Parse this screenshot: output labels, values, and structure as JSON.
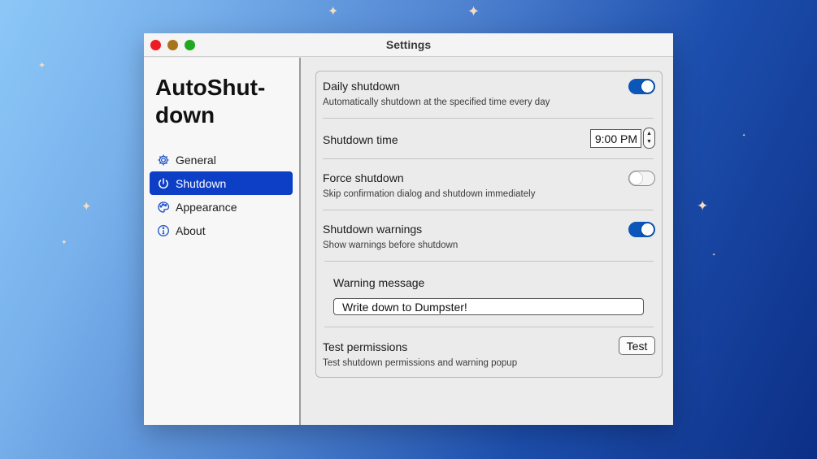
{
  "window": {
    "title": "Settings"
  },
  "sidebar": {
    "app_name": "AutoShut-down",
    "items": [
      {
        "label": "General",
        "icon": "gear-icon",
        "active": false
      },
      {
        "label": "Shutdown",
        "icon": "power-icon",
        "active": true
      },
      {
        "label": "Appearance",
        "icon": "palette-icon",
        "active": false
      },
      {
        "label": "About",
        "icon": "info-icon",
        "active": false
      }
    ]
  },
  "settings": {
    "daily_shutdown": {
      "label": "Daily shutdown",
      "desc": "Automatically shutdown at the specified time every day",
      "enabled": true
    },
    "shutdown_time": {
      "label": "Shutdown time",
      "value": "9:00 PM"
    },
    "force_shutdown": {
      "label": "Force shutdown",
      "desc": "Skip confirmation dialog and shutdown immediately",
      "enabled": false
    },
    "shutdown_warnings": {
      "label": "Shutdown warnings",
      "desc": "Show warnings before shutdown",
      "enabled": true
    },
    "warning_message": {
      "label": "Warning message",
      "value": "Write down to Dumpster!"
    },
    "test_permissions": {
      "label": "Test permissions",
      "desc": "Test shutdown permissions and warning popup",
      "button": "Test"
    }
  },
  "colors": {
    "accent": "#0d3ec6",
    "toggle_on": "#0b56b8"
  }
}
